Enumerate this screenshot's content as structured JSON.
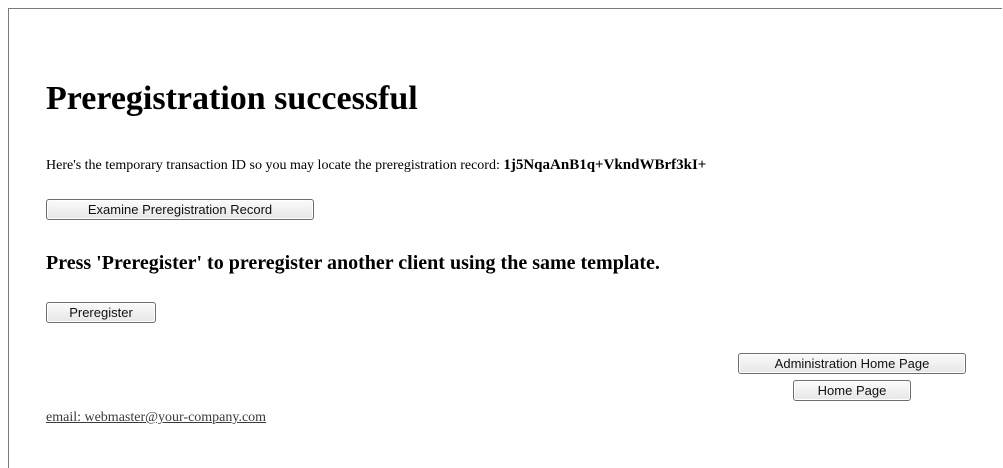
{
  "page": {
    "title": "Preregistration successful",
    "transaction_text": "Here's the temporary transaction ID so you may locate the preregistration record: ",
    "transaction_id": "1j5NqaAnB1q+VkndWBrf3kI+",
    "sub_heading": "Press 'Preregister' to preregister another client using the same template."
  },
  "buttons": {
    "examine": "Examine Preregistration Record",
    "preregister": "Preregister",
    "admin_home": "Administration Home Page",
    "home": "Home Page"
  },
  "footer": {
    "email": "email: webmaster@your-company.com"
  }
}
